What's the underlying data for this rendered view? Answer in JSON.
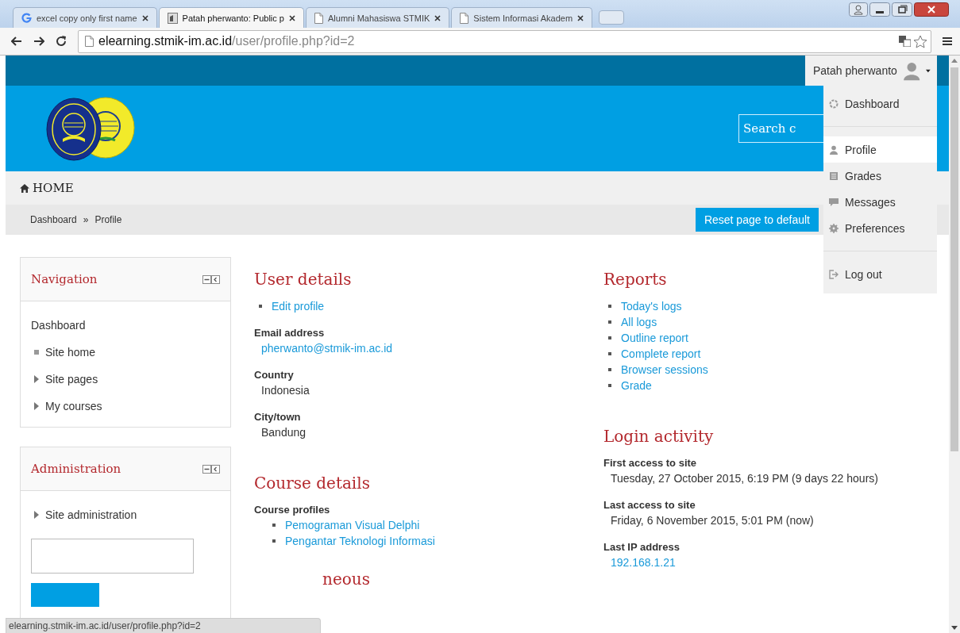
{
  "browser": {
    "tabs": [
      {
        "title": "excel copy only first name",
        "selected": false
      },
      {
        "title": "Patah pherwanto: Public p",
        "selected": true
      },
      {
        "title": "Alumni Mahasiswa STMIK",
        "selected": false
      },
      {
        "title": "Sistem Informasi Akadem",
        "selected": false
      }
    ],
    "address": {
      "host": "elearning.stmik-im.ac.id",
      "path": "/user/profile.php?id=2"
    }
  },
  "user_menu": {
    "name": "Patah pherwanto",
    "groups": [
      [
        {
          "label": "Dashboard",
          "selected": false
        }
      ],
      [
        {
          "label": "Profile",
          "selected": true
        },
        {
          "label": "Grades",
          "selected": false
        },
        {
          "label": "Messages",
          "selected": false
        },
        {
          "label": "Preferences",
          "selected": false
        }
      ],
      [
        {
          "label": "Log out",
          "selected": false
        }
      ]
    ]
  },
  "header": {
    "search": {
      "placeholder": "Search c"
    }
  },
  "home_link": "HOME",
  "breadcrumb": {
    "items": [
      "Dashboard",
      "Profile"
    ],
    "separator": "»"
  },
  "reset_button": "Reset page to default",
  "blocks": [
    {
      "title": "Navigation",
      "has_search": false,
      "items": [
        {
          "label": "Dashboard",
          "kind": "plain"
        },
        {
          "label": "Site home",
          "kind": "leaf"
        },
        {
          "label": "Site pages",
          "kind": "branch"
        },
        {
          "label": "My courses",
          "kind": "branch"
        }
      ]
    },
    {
      "title": "Administration",
      "has_search": true,
      "items": [
        {
          "label": "Site administration",
          "kind": "branch"
        }
      ]
    }
  ],
  "columns": [
    [
      {
        "heading": "User details",
        "entries": [
          {
            "kind": "links",
            "items": [
              "Edit profile"
            ]
          },
          {
            "kind": "field",
            "label": "Email address",
            "value": "pherwanto@stmik-im.ac.id",
            "link": true
          },
          {
            "kind": "field",
            "label": "Country",
            "value": "Indonesia",
            "link": false
          },
          {
            "kind": "field",
            "label": "City/town",
            "value": "Bandung",
            "link": false
          }
        ]
      },
      {
        "heading": "Course details",
        "entries": [
          {
            "kind": "field_links",
            "label": "Course profiles",
            "items": [
              "Pemograman Visual Delphi",
              "Pengantar Teknologi Informasi"
            ]
          }
        ]
      },
      {
        "heading": "neous"
      }
    ],
    [
      {
        "heading": "Reports",
        "entries": [
          {
            "kind": "links",
            "items": [
              "Today's logs",
              "All logs",
              "Outline report",
              "Complete report",
              "Browser sessions",
              "Grade"
            ]
          }
        ]
      },
      {
        "heading": "Login activity",
        "entries": [
          {
            "kind": "field",
            "label": "First access to site",
            "value": "Tuesday, 27 October 2015, 6:19 PM  (9 days 22 hours)",
            "link": false
          },
          {
            "kind": "field",
            "label": "Last access to site",
            "value": "Friday, 6 November 2015, 5:01 PM  (now)",
            "link": false
          },
          {
            "kind": "field",
            "label": "Last IP address",
            "value": "192.168.1.21",
            "link": true
          }
        ]
      }
    ]
  ],
  "status_bar": "elearning.stmik-im.ac.id/user/profile.php?id=2"
}
